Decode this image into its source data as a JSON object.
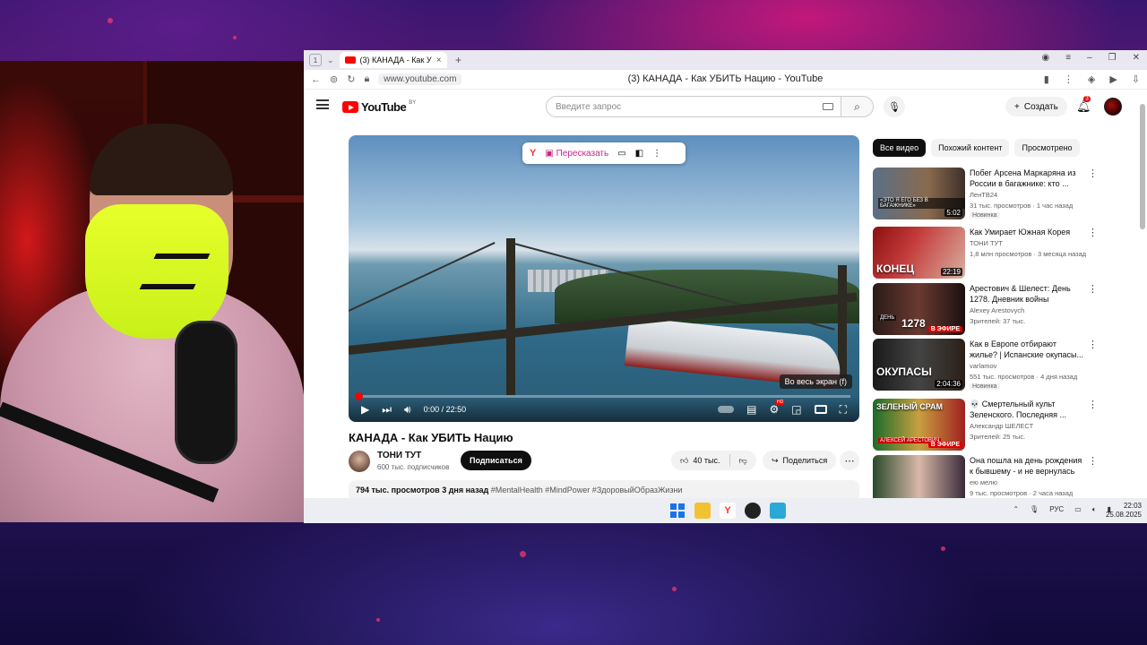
{
  "browser": {
    "tab_count": "1",
    "tab_title": "(3) КАНАДА - Как УБИТ",
    "url": "www.youtube.com",
    "page_title": "(3) КАНАДА - Как УБИТЬ Нацию - YouTube"
  },
  "youtube": {
    "logo_text": "YouTube",
    "logo_country": "BY",
    "search_placeholder": "Введите запрос",
    "create_label": "Создать",
    "notifications": "3"
  },
  "player": {
    "retell_label": "Пересказать",
    "time": "0:00 / 22:50",
    "tooltip": "Во весь экран (f)",
    "progress": 0.0
  },
  "video": {
    "title": "КАНАДА - Как УБИТЬ Нацию",
    "channel": "ТОНИ ТУТ",
    "subscribers": "600 тыс. подписчиков",
    "subscribe_label": "Подписаться",
    "likes": "40 тыс.",
    "share_label": "Поделиться",
    "views": "794 тыс. просмотров",
    "date": "3 дня назад",
    "tags": "#MentalHealth #MindPower #ЗдоровыйОбразЖизни"
  },
  "sidebar": {
    "chips": [
      "Все видео",
      "Похожий контент",
      "Просмотрено"
    ],
    "recs": [
      {
        "title": "Побег Арсена Маркаряна из России в багажнике: кто ...",
        "channel": "ЛенТВ24",
        "meta": "31 тыс. просмотров · 1 час назад",
        "badge": "Новинка",
        "duration": "5:02",
        "thumb_text": "",
        "thumb_sub": "«ЭТО Я ЕГО БЕЗ В БАГАЖНИКЕ»"
      },
      {
        "title": "Как Умирает Южная Корея",
        "channel": "ТОНИ ТУТ",
        "meta": "1,8 млн просмотров · 3 месяца назад",
        "badge": "",
        "duration": "22:19",
        "thumb_text": "КОНЕЦ",
        "thumb_sub": ""
      },
      {
        "title": "Арестович & Шелест: День 1278. Дневник войны",
        "channel": "Alexey Arestovych",
        "meta": "Зрителей: 37 тыс.",
        "badge": "",
        "duration": "",
        "live": "В ЭФИРЕ",
        "thumb_text": "1278",
        "thumb_sub": "ДЕНЬ"
      },
      {
        "title": "Как в Европе отбирают жилье? | Испанские окупасы...",
        "channel": "varlamov",
        "meta": "551 тыс. просмотров · 4 дня назад",
        "badge": "Новинка",
        "duration": "2:04:36",
        "thumb_text": "ОКУПАСЫ",
        "thumb_sub": ""
      },
      {
        "title": "💀 Смертельный культ Зеленского. Последняя ...",
        "channel": "Александр ШЕЛЕСТ",
        "meta": "Зрителей: 25 тыс.",
        "badge": "",
        "duration": "",
        "live": "В ЭФИРЕ",
        "thumb_text": "ЗЕЛЕНЫЙ СРАМ",
        "thumb_sub": "АЛЕКСЕЙ АРЕСТОВИЧ"
      },
      {
        "title": "Она пошла на день рождения к бывшему - и не вернулась",
        "channel": "ею мелю",
        "meta": "9 тыс. просмотров · 2 часа назад",
        "badge": "",
        "duration": "",
        "thumb_text": "",
        "thumb_sub": ""
      }
    ]
  },
  "taskbar": {
    "lang": "РУС",
    "time": "22:03",
    "date": "25.08.2025"
  }
}
